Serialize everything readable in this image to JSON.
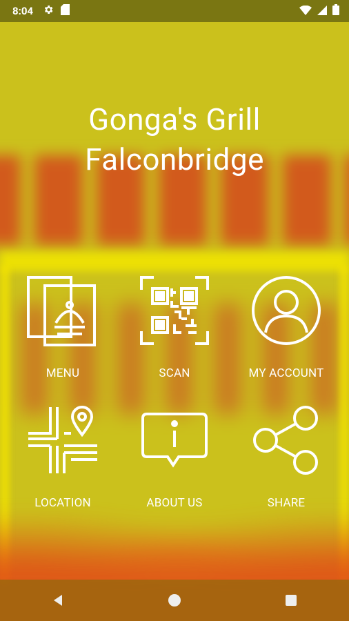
{
  "status_bar": {
    "time": "8:04"
  },
  "header": {
    "line1": "Gonga's Grill",
    "line2": "Falconbridge"
  },
  "tiles": [
    {
      "label": "MENU",
      "icon": "menu-icon"
    },
    {
      "label": "SCAN",
      "icon": "qr-code-icon"
    },
    {
      "label": "MY ACCOUNT",
      "icon": "account-icon"
    },
    {
      "label": "LOCATION",
      "icon": "location-map-icon"
    },
    {
      "label": "ABOUT US",
      "icon": "info-chat-icon"
    },
    {
      "label": "SHARE",
      "icon": "share-icon"
    }
  ],
  "colors": {
    "background": "#cbc11c",
    "accent_red": "#d6241c",
    "text": "#ffffff"
  }
}
